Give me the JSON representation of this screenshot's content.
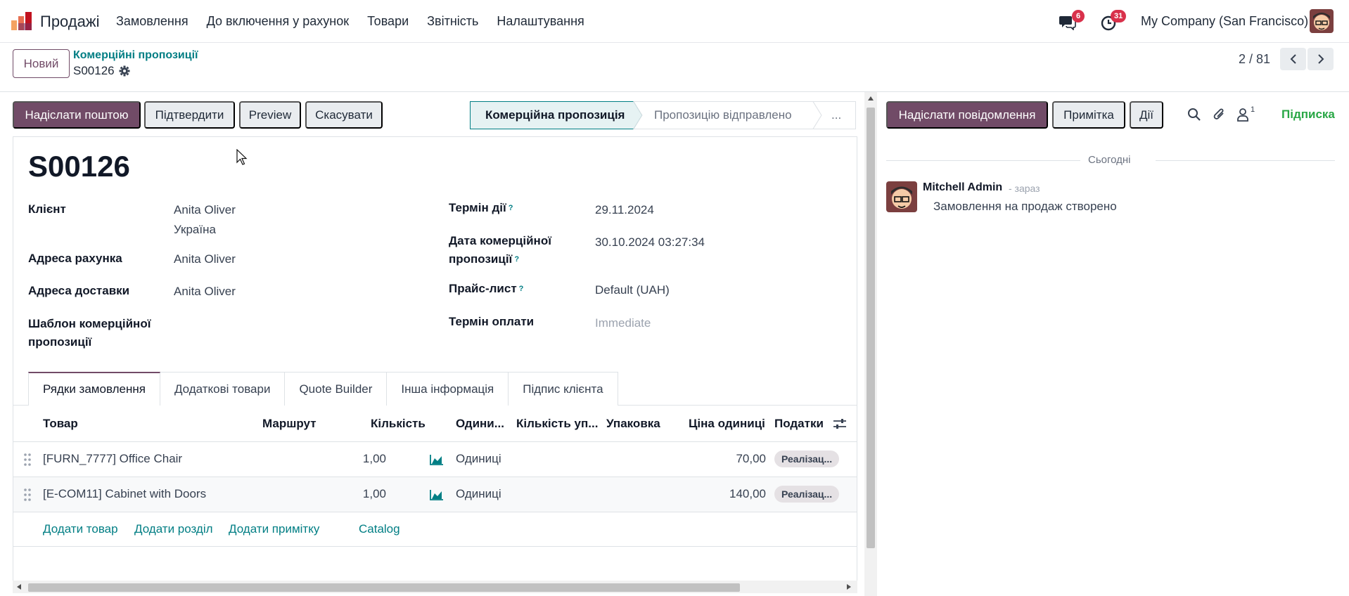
{
  "navbar": {
    "app_name": "Продажі",
    "menu": [
      "Замовлення",
      "До включення у рахунок",
      "Товари",
      "Звітність",
      "Налаштування"
    ],
    "messages_badge": "6",
    "activities_badge": "31",
    "company": "My Company (San Francisco)"
  },
  "control_panel": {
    "new_button": "Новий",
    "breadcrumb_parent": "Комерційні пропозиції",
    "record_name": "S00126",
    "pager": "2 / 81"
  },
  "statusbar": {
    "buttons": [
      "Надіслати поштою",
      "Підтвердити",
      "Preview",
      "Скасувати"
    ],
    "stages": [
      "Комерційна пропозиція",
      "Пропозицію відправлено",
      "..."
    ]
  },
  "form": {
    "title": "S00126",
    "left_fields": [
      {
        "label": "Клієнт",
        "value": "Anita Oliver",
        "value2": "Україна"
      },
      {
        "label": "Адреса рахунка",
        "value": "Anita Oliver"
      },
      {
        "label": "Адреса доставки",
        "value": "Anita Oliver"
      },
      {
        "label": "Шаблон комерційної",
        "label2": "пропозиції",
        "value": ""
      }
    ],
    "right_fields": [
      {
        "label": "Термін дії",
        "help": "?",
        "value": "29.11.2024"
      },
      {
        "label": "Дата комерційної",
        "label2": "пропозиції",
        "help": "?",
        "value": "30.10.2024 03:27:34"
      },
      {
        "label": "Прайс-лист",
        "help": "?",
        "value": "Default (UAH)"
      },
      {
        "label": "Термін оплати",
        "value": "Immediate"
      }
    ],
    "tabs": [
      "Рядки замовлення",
      "Додаткові товари",
      "Quote Builder",
      "Інша інформація",
      "Підпис клієнта"
    ],
    "columns": [
      "Товар",
      "Маршрут",
      "Кількість",
      "Одини...",
      "Кількість уп...",
      "Упаковка",
      "Ціна одиниці",
      "Податки"
    ],
    "lines": [
      {
        "product": "[FURN_7777] Office Chair",
        "qty": "1,00",
        "uom": "Одиниці",
        "price": "70,00",
        "tax": "Реалізац..."
      },
      {
        "product": "[E-COM11] Cabinet with Doors",
        "qty": "1,00",
        "uom": "Одиниці",
        "price": "140,00",
        "tax": "Реалізац..."
      }
    ],
    "add_links": [
      "Додати товар",
      "Додати розділ",
      "Додати примітку",
      "Catalog"
    ]
  },
  "chatter": {
    "send_message": "Надіслати повідомлення",
    "log_note": "Примітка",
    "activities": "Дії",
    "followers_count": "1",
    "follow": "Підписка",
    "today": "Сьогодні",
    "message": {
      "author": "Mitchell Admin",
      "time": "- зараз",
      "body": "Замовлення на продаж створено"
    }
  },
  "colors": {
    "primary": "#714b67",
    "link": "#017e84",
    "follow": "#28a745",
    "badge": "#d9314b"
  }
}
